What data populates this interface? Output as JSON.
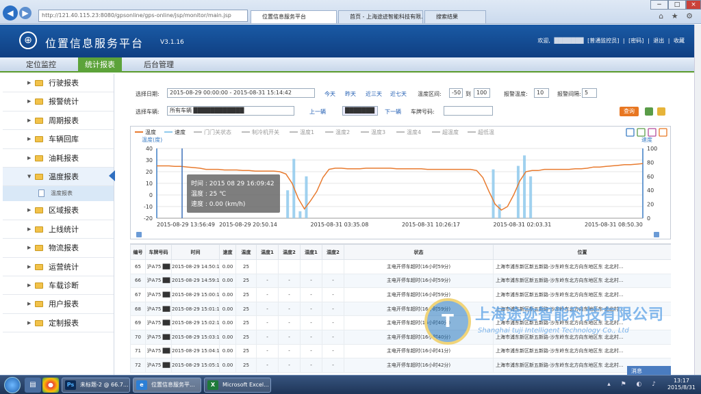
{
  "browser": {
    "url": "http://121.40.115.23:8080/gpsonline/gps-online/jsp/monitor/main.jsp",
    "tabs": [
      "位置信息服务平台",
      "首页 - 上海途迹智能科技有限...",
      "搜索结果"
    ],
    "win": {
      "min": "−",
      "max": "□",
      "close": "×"
    },
    "icons": "⌂ ★ ⚙"
  },
  "header": {
    "title": "位置信息服务平台",
    "version": "V3.1.16",
    "user_label": "欢迎,",
    "user_name": "███████",
    "links": [
      "[普通监控员]",
      "[密码]",
      "退出",
      "收藏"
    ]
  },
  "menu": [
    "定位监控",
    "统计报表",
    "后台管理"
  ],
  "sidebar": {
    "items": [
      "行驶报表",
      "报警统计",
      "周期报表",
      "车辆回库",
      "油耗报表",
      "温度报表",
      "区域报表",
      "上线统计",
      "物流报表",
      "运营统计",
      "车载诊断",
      "用户报表",
      "定制报表"
    ],
    "sub_item": "温度报表"
  },
  "filter": {
    "date_label": "选择日期:",
    "date_value": "2015-08-29 00:00:00 - 2015-08-31 15:14:42",
    "quick": [
      "今天",
      "昨天",
      "近三天",
      "近七天"
    ],
    "temp_label": "温度区间:",
    "temp_from": "-50",
    "to_label": "到",
    "temp_to": "100",
    "report_label": "报警温度:",
    "report_value": "10",
    "interval_label": "报警间隔:",
    "interval_value": "5",
    "vehicle_label": "选择车辆:",
    "vehicle_value": "所有车辆 ████████████",
    "prev": "上一辆",
    "select_value": "███████",
    "next": "下一辆",
    "plate_label": "车牌号码:",
    "plate_value": "",
    "query_btn": "查询"
  },
  "legend": [
    "温度",
    "速度",
    "门门关状态",
    "制冷机开关",
    "温度1",
    "温度2",
    "温度3",
    "温度4",
    "超温度",
    "超低温"
  ],
  "left_axis_title": "温度(度)",
  "right_axis_title": "速度",
  "tooltip": {
    "time": "时间 : 2015 08 29 16:09:42",
    "temp": "温度 : 25 ℃",
    "speed": "速度 : 0.00 (km/h)"
  },
  "chart_data": {
    "type": "line",
    "x_ticks": [
      "2015-08-29 13:56:49",
      "2015-08-29 20:50.14",
      "2015-08-31 03:35.08",
      "2015-08-31 10:26:17",
      "2015-08-31 02:03.31",
      "2015-08-31 08:50.30"
    ],
    "left_ticks": [
      40,
      30,
      20,
      10,
      0,
      -10,
      -20
    ],
    "right_ticks": [
      100,
      80,
      60,
      40,
      20,
      0
    ],
    "ylim": [
      -20,
      40
    ],
    "y2lim": [
      0,
      100
    ],
    "series": [
      {
        "name": "温度",
        "color": "#e87a2e",
        "values": [
          25,
          25,
          25,
          24.5,
          24.5,
          24,
          23.5,
          23,
          22,
          22,
          22,
          21.5,
          21.5,
          21.5,
          21,
          21,
          20.5,
          20.5,
          20.5,
          20.5,
          20,
          18,
          10,
          -3,
          -12,
          -5,
          3,
          15,
          22,
          23,
          23,
          22.5,
          22.5,
          22.5,
          23,
          23,
          23,
          23,
          23,
          22.5,
          22.5,
          22.5,
          22.5,
          22.5,
          22,
          22,
          22,
          22,
          22,
          22,
          22,
          22,
          21,
          15,
          3,
          -8,
          -13,
          -10,
          0,
          12,
          20,
          21,
          21,
          22,
          22,
          22,
          22,
          22,
          22.5,
          22.5,
          23,
          24,
          24,
          24.5,
          25,
          25.5,
          26,
          26,
          26.5,
          27
        ]
      },
      {
        "name": "速度",
        "color": "#8fc9ec",
        "values": [
          0,
          0,
          0,
          0,
          0,
          0,
          0,
          0,
          0,
          0,
          0,
          0,
          0,
          0,
          0,
          0,
          0,
          0,
          0,
          0,
          0,
          40,
          85,
          10,
          60,
          0,
          0,
          0,
          0,
          0,
          0,
          0,
          0,
          0,
          0,
          0,
          0,
          0,
          0,
          0,
          0,
          0,
          0,
          0,
          0,
          0,
          0,
          0,
          0,
          0,
          0,
          0,
          0,
          0,
          70,
          20,
          0,
          0,
          75,
          90,
          60,
          0,
          0,
          0,
          0,
          0,
          0,
          0,
          0,
          0,
          0,
          0,
          0,
          0,
          0,
          0,
          0,
          0,
          0
        ]
      }
    ]
  },
  "table": {
    "headers": [
      "编号",
      "车牌号码",
      "时间",
      "速度",
      "温度",
      "温度1",
      "温度2",
      "湿度1",
      "湿度2",
      "状态",
      "位置"
    ],
    "rows": [
      [
        "65",
        "沪A75 ██",
        "2015-08-29 14:50:11",
        "0.00",
        "25",
        "",
        "",
        "",
        "",
        "主电开停车超时(16小时59分)",
        "上海市浦东新区新五新路-沙东岭东北方向东地区东 北北村..."
      ],
      [
        "66",
        "沪A75 ██",
        "2015-08-29 14:59:12",
        "0.00",
        "25",
        "-",
        "-",
        "-",
        "-",
        "主电开停车超时(16小时59分)",
        "上海市浦东新区新五新路-沙东岭东北方向东地区东 北北村..."
      ],
      [
        "67",
        "沪A75 ██",
        "2015-08-29 15:00:12",
        "0.00",
        "25",
        "-",
        "-",
        "-",
        "-",
        "主电开停车超时(16小时59分)",
        "上海市浦东新区新五新路-沙东岭东北方向东地区东 北北村..."
      ],
      [
        "68",
        "沪A75 ██",
        "2015-08-29 15:01:12",
        "0.00",
        "25",
        "-",
        "-",
        "-",
        "-",
        "主电开停车超时(16小时59分)",
        "上海市浦东新区新五新路-沙东岭东北方向东地区东 北北村..."
      ],
      [
        "69",
        "沪A75 ██",
        "2015-08-29 15:02:13",
        "0.00",
        "25",
        "-",
        "-",
        "-",
        "-",
        "主电开停车超时(16小时40分)",
        "上海市浦东新区新五新路-沙东岭东北方向东地区东 北北村..."
      ],
      [
        "70",
        "沪A75 ██",
        "2015-08-29 15:03:11",
        "0.00",
        "25",
        "-",
        "-",
        "-",
        "-",
        "主电开停车超时(16小时40分)",
        "上海市浦东新区新五新路-沙东岭东北方向东地区东 北北村..."
      ],
      [
        "71",
        "沪A75 ██",
        "2015-08-29 15:04:14",
        "0.00",
        "25",
        "-",
        "-",
        "-",
        "-",
        "主电开停车超时(16小时41分)",
        "上海市浦东新区新五新路-沙东岭东北方向东地区东 北北村..."
      ],
      [
        "72",
        "沪A75 ██",
        "2015-08-29 15:05:14",
        "0.00",
        "25",
        "-",
        "-",
        "-",
        "-",
        "主电开停车超时(16小时42分)",
        "上海市浦东新区新五新路-沙东岭东北方向东地区东 北北村..."
      ]
    ]
  },
  "watermark": {
    "cn": "上海途迹智能科技有限公司",
    "en": "Shanghai tuji Intelligent Technology Co., Ltd",
    "glyph": "T"
  },
  "message_label": "消息",
  "taskbar": {
    "tasks": [
      "未标题-2 @ 66.7...",
      "位置信息服务平...",
      "Microsoft Excel..."
    ],
    "time": "13:17",
    "date": "2015/8/31"
  }
}
